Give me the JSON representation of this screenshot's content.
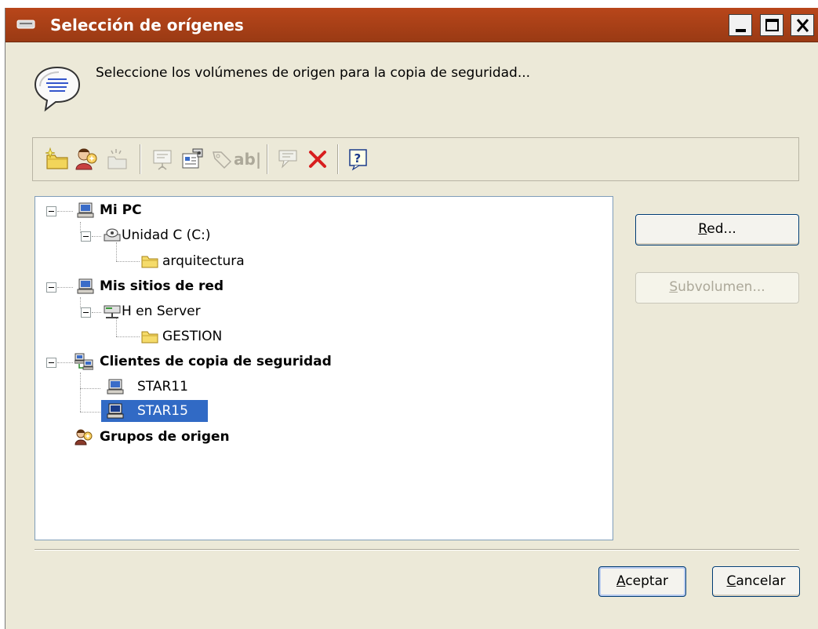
{
  "window": {
    "title": "Selección de orígenes",
    "controls": {
      "minimize": "minimize",
      "maximize": "maximize",
      "close": "close"
    }
  },
  "message": {
    "text": "Seleccione los volúmenes de origen para la copia de seguridad...",
    "icon": "speech-bubble-icon"
  },
  "toolbar": {
    "items": [
      {
        "name": "new-folder-icon",
        "enabled": true
      },
      {
        "name": "users-icon",
        "enabled": true
      },
      {
        "name": "folder-action-icon",
        "enabled": false
      },
      {
        "name": "presentation-icon",
        "enabled": false
      },
      {
        "name": "properties-icon",
        "enabled": true
      },
      {
        "name": "tag-icon",
        "enabled": false
      },
      {
        "name": "rename-icon",
        "enabled": false
      },
      {
        "name": "comment-icon",
        "enabled": false
      },
      {
        "name": "delete-icon",
        "enabled": true
      },
      {
        "name": "help-icon",
        "enabled": true
      }
    ],
    "rename_text": "ab|"
  },
  "tree": {
    "nodes": [
      {
        "label": "Mi PC",
        "icon": "computer-icon",
        "level": 0,
        "bold": true
      },
      {
        "label": "Unidad C (C:)",
        "icon": "drive-icon",
        "level": 1,
        "bold": false
      },
      {
        "label": "arquitectura",
        "icon": "folder-icon",
        "level": 2,
        "bold": false
      },
      {
        "label": "Mis sitios de red",
        "icon": "network-places-icon",
        "level": 0,
        "bold": true
      },
      {
        "label": "H en Server",
        "icon": "network-drive-icon",
        "level": 1,
        "bold": false
      },
      {
        "label": "GESTION",
        "icon": "folder-icon",
        "level": 2,
        "bold": false
      },
      {
        "label": "Clientes de copia de seguridad",
        "icon": "backup-clients-icon",
        "level": 0,
        "bold": true
      },
      {
        "label": "STAR11",
        "icon": "computer-icon",
        "level": 1,
        "bold": false
      },
      {
        "label": "STAR15",
        "icon": "computer-icon",
        "level": 1,
        "bold": false,
        "selected": true
      },
      {
        "label": "Grupos de origen",
        "icon": "source-groups-icon",
        "level": 0,
        "bold": true
      }
    ]
  },
  "buttons": {
    "red": {
      "mnemonic": "R",
      "rest": "ed..."
    },
    "subvolumen": {
      "mnemonic": "S",
      "rest": "ubvolumen..."
    },
    "aceptar": {
      "mnemonic": "A",
      "rest": "ceptar"
    },
    "cancelar": {
      "mnemonic": "C",
      "rest": "ancelar"
    }
  },
  "colors": {
    "titlebar": "#a83f16",
    "dialog_bg": "#ece9d8",
    "selection": "#316ac5"
  }
}
